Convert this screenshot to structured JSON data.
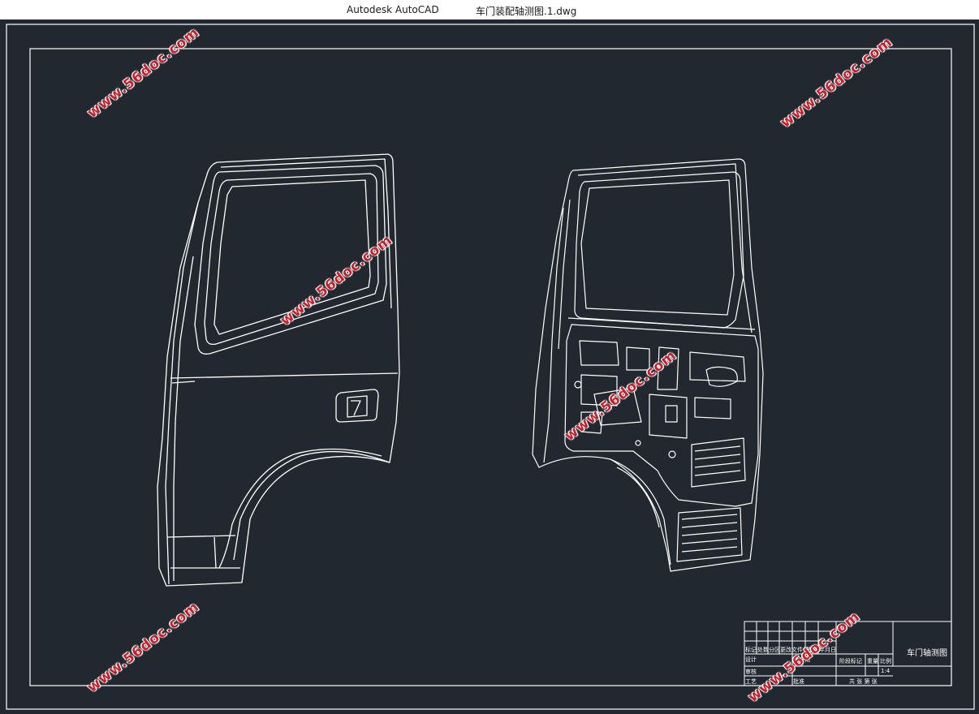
{
  "window": {
    "app_name": "Autodesk AutoCAD",
    "file_name": "车门装配轴测图.1.dwg"
  },
  "watermark": "www.56doc.com",
  "title_block": {
    "drawing_title": "车门轴测图",
    "row_labels": [
      "标记",
      "处数",
      "分区",
      "更改文件号",
      "签名",
      "年月日"
    ],
    "design": "设计",
    "standardize": "标准化",
    "stage_mark": "阶段标记",
    "weight": "重量",
    "scale": "比例",
    "scale_value": "1:4",
    "review": "审核",
    "process": "工艺",
    "approve": "批准",
    "sheets": "共 张 第 张"
  },
  "colors": {
    "background": "#212830",
    "linework": "#ffffff",
    "watermark": "#c8202a"
  }
}
